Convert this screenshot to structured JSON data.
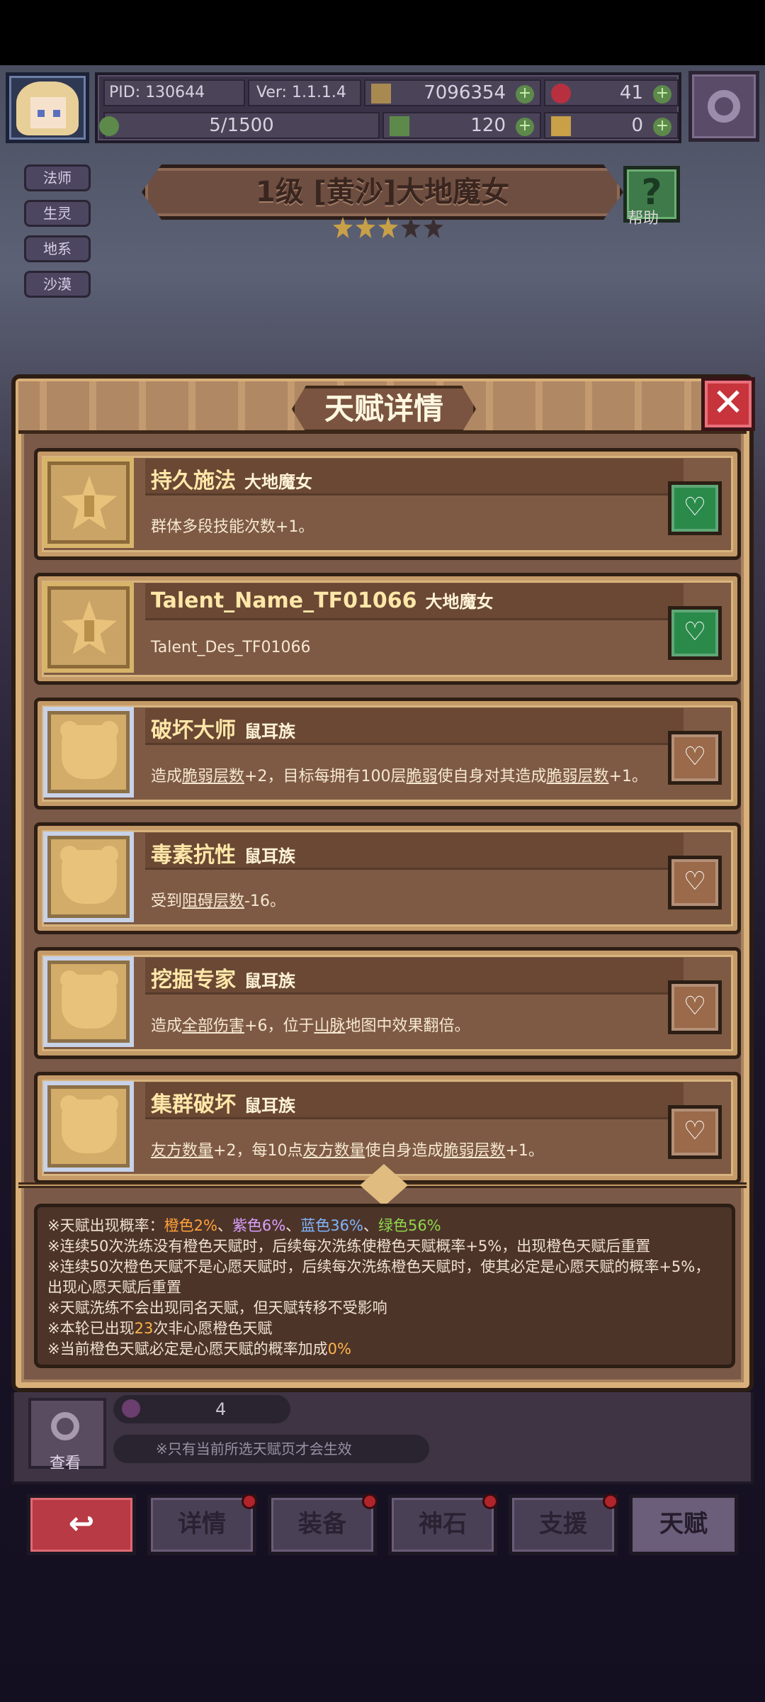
{
  "hud": {
    "pid": "PID: 130644",
    "version": "Ver: 1.1.1.4",
    "coins": "7096354",
    "gems": "41",
    "progress": "5/1500",
    "clovers": "120",
    "keys": "0",
    "plus": "+"
  },
  "hero": {
    "tags": [
      "法师",
      "生灵",
      "地系",
      "沙漠"
    ],
    "title": "1级 [黄沙]大地魔女",
    "help_label": "帮助",
    "help_symbol": "?",
    "stars_on": 3,
    "stars_total": 5
  },
  "modal": {
    "title": "天赋详情",
    "close_symbol": "✕",
    "talents": [
      {
        "name": "持久施法",
        "race": "大地魔女",
        "desc": "群体多段技能次数+1。",
        "frame": "gold",
        "icon": "star-icon",
        "favorite": true
      },
      {
        "name": "Talent_Name_TF01066",
        "race": "大地魔女",
        "desc": "Talent_Des_TF01066",
        "frame": "gold",
        "icon": "star-icon",
        "favorite": true
      },
      {
        "name": "破坏大师",
        "race": "鼠耳族",
        "desc_parts": [
          "造成",
          "脆弱层数",
          "+2，目标每拥有100层",
          "脆弱",
          "使自身对其造成",
          "脆弱层数",
          "+1。"
        ],
        "frame": "silver",
        "icon": "bear-icon",
        "favorite": false
      },
      {
        "name": "毒素抗性",
        "race": "鼠耳族",
        "desc_parts": [
          "受到",
          "阻碍层数",
          "-16。"
        ],
        "frame": "silver",
        "icon": "bear-icon",
        "favorite": false
      },
      {
        "name": "挖掘专家",
        "race": "鼠耳族",
        "desc_parts": [
          "造成",
          "全部伤害",
          "+6，位于",
          "山脉",
          "地图中效果翻倍。"
        ],
        "frame": "silver",
        "icon": "bear-icon",
        "favorite": false
      },
      {
        "name": "集群破坏",
        "race": "鼠耳族",
        "desc_parts": [
          "友方数量",
          "+2，每10点",
          "友方数量",
          "使自身造成",
          "脆弱层数",
          "+1。"
        ],
        "frame": "silver",
        "icon": "bear-icon",
        "favorite": false
      }
    ],
    "info": {
      "line1_prefix": "※天赋出现概率：",
      "orange": "橙色2%",
      "sep1": "、",
      "purple": "紫色6%",
      "sep2": "、",
      "blue": "蓝色36%",
      "sep3": "、",
      "green": "绿色56%",
      "line2": "※连续50次洗练没有橙色天赋时，后续每次洗练使橙色天赋概率+5%，出现橙色天赋后重置",
      "line3": "※连续50次橙色天赋不是心愿天赋时，后续每次洗练橙色天赋时，使其必定是心愿天赋的概率+5%，出现心愿天赋后重置",
      "line4": "※天赋洗练不会出现同名天赋，但天赋转移不受影响",
      "line5_prefix": "※本轮已出现",
      "line5_num": "23",
      "line5_suffix": "次非心愿橙色天赋",
      "line6_prefix": "※当前橙色天赋必定是心愿天赋的概率加成",
      "line6_num": "0%"
    }
  },
  "bottom": {
    "count": "4",
    "view_label": "查看",
    "note": "※只有当前所选天赋页才会生效",
    "nav": [
      {
        "label": "↩",
        "name": "back-button"
      },
      {
        "label": "详情",
        "name": "tab-details"
      },
      {
        "label": "装备",
        "name": "tab-equipment"
      },
      {
        "label": "神石",
        "name": "tab-godstone"
      },
      {
        "label": "支援",
        "name": "tab-support"
      },
      {
        "label": "天赋",
        "name": "tab-talent"
      }
    ]
  },
  "colors": {
    "accent_orange": "#ffa23a",
    "purple": "#d8a0ff",
    "blue": "#7fb6ff",
    "green": "#8ed84c",
    "close_red": "#c8343c",
    "fav_green": "#2a8a4a"
  }
}
